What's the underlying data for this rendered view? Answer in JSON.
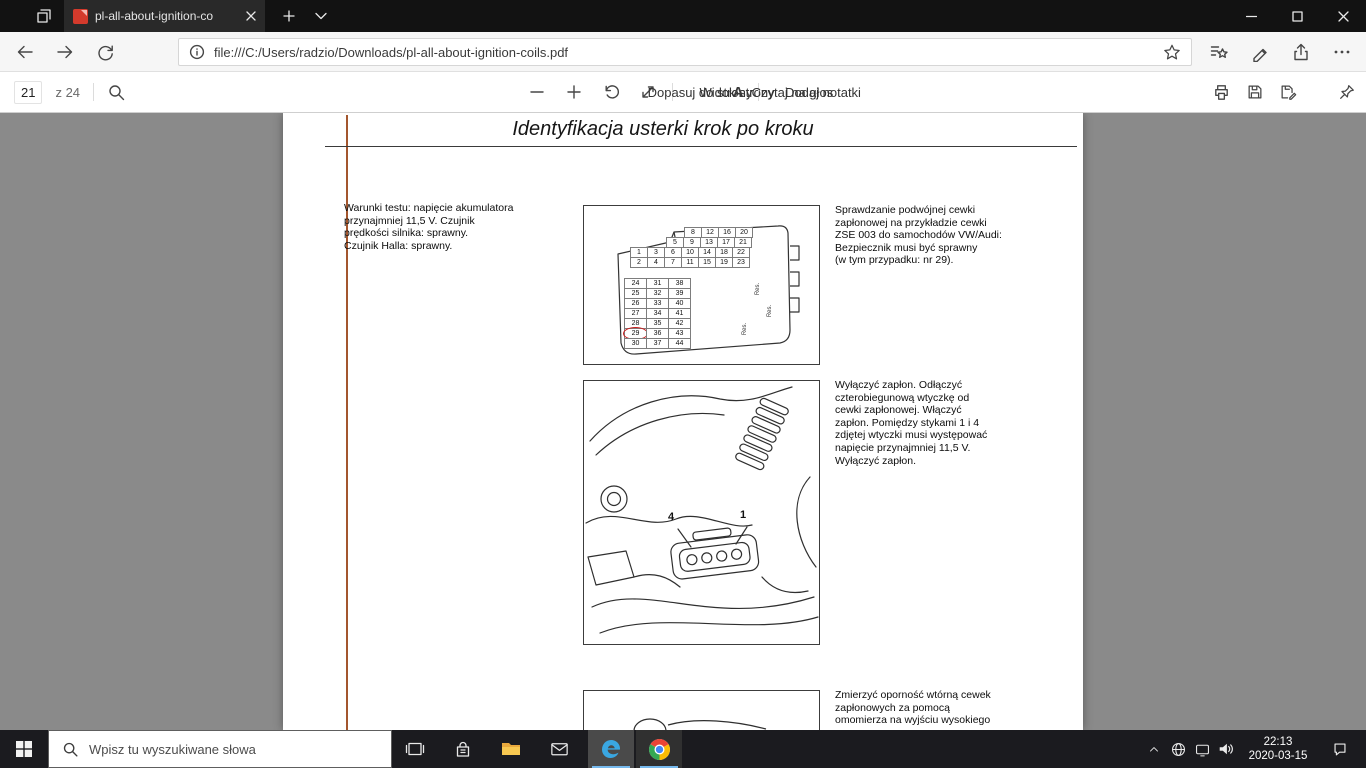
{
  "colors": {
    "fuse_highlight": "#cc2020",
    "page_rule": "#a3562e",
    "taskbar_accent": "#76b9ed"
  },
  "browser": {
    "tab": {
      "title": "pl-all-about-ignition-co"
    },
    "address": {
      "url": "file:///C:/Users/radzio/Downloads/pl-all-about-ignition-coils.pdf"
    }
  },
  "pdf_toolbar": {
    "page_number": "21",
    "page_count": "z 24",
    "fit_to_page": "Dopasuj do strony",
    "page_view": "Widok strony",
    "read_aloud": "Czytaj na głos",
    "read_aloud_icon_letter": "A",
    "add_notes": "Dodaj notatki"
  },
  "document": {
    "title": "Identyfikacja usterki krok po kroku",
    "test_conditions": "Warunki testu: napięcie akumulatora\nprzynajmniej 11,5 V. Czujnik\nprędkości silnika: sprawny.\nCzujnik Halla: sprawny.",
    "steps": [
      {
        "text": "Sprawdzanie podwójnej cewki\nzapłonowej na przykładzie cewki\nZSE 003 do samochodów VW/Audi:\nBezpiecznik musi być sprawny\n(w tym przypadku: nr 29)."
      },
      {
        "text": "Wyłączyć zapłon. Odłączyć\nczterobiegunową wtyczkę od\ncewki zapłonowej. Włączyć\nzapłon. Pomiędzy stykami 1 i 4\nzdjętej wtyczki musi występować\nnapięcie przynajmniej 11,5 V.\nWyłączyć zapłon."
      },
      {
        "text": "Zmierzyć oporność wtórną cewek\nzapłonowych za pomocą\nomomierza na wyjściu wysokiego"
      }
    ],
    "fusebox": {
      "top_rows": [
        [
          "8",
          "12",
          "16",
          "20"
        ],
        [
          "5",
          "9",
          "13",
          "17",
          "21"
        ],
        [
          "1",
          "3",
          "6",
          "10",
          "14",
          "18",
          "22"
        ],
        [
          "2",
          "4",
          "7",
          "11",
          "15",
          "19",
          "23"
        ]
      ],
      "bottom_rows": [
        [
          "24",
          "31",
          "38"
        ],
        [
          "25",
          "32",
          "39"
        ],
        [
          "26",
          "33",
          "40"
        ],
        [
          "27",
          "34",
          "41"
        ],
        [
          "28",
          "35",
          "42"
        ],
        [
          "29",
          "36",
          "43"
        ],
        [
          "30",
          "37",
          "44"
        ]
      ],
      "res_labels": [
        "Res.",
        "Res.",
        "Res."
      ],
      "highlight_fuse": "29"
    },
    "connector_labels": {
      "left": "4",
      "right": "1"
    }
  },
  "taskbar": {
    "search_placeholder": "Wpisz tu wyszukiwane słowa",
    "clock": {
      "time": "22:13",
      "date": "2020-03-15"
    }
  }
}
